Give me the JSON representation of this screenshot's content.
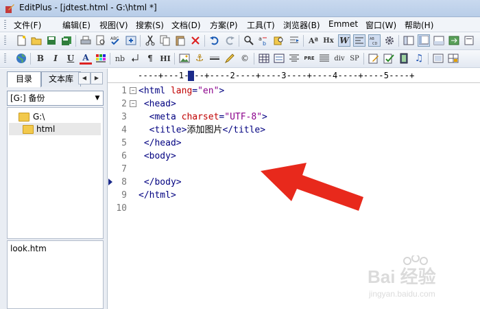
{
  "window": {
    "title": "EditPlus - [jdtest.html - G:\\html *]"
  },
  "menu": {
    "items": [
      "文件(F)",
      "编辑(E)",
      "视图(V)",
      "搜索(S)",
      "文档(D)",
      "方案(P)",
      "工具(T)",
      "浏览器(B)",
      "Emmet",
      "窗口(W)",
      "帮助(H)"
    ]
  },
  "toolbar2": {
    "bold": "B",
    "italic": "I",
    "underline": "U",
    "font": "A",
    "nbsp": "nb",
    "paragraph": "¶",
    "hi": "HI",
    "pre": "PRE",
    "div": "div",
    "span": "SP"
  },
  "sidebar": {
    "tabs": [
      "目录",
      "文本库"
    ],
    "drive": "[G:] 备份",
    "tree": [
      "G:\\",
      "html"
    ],
    "files": [
      "look.htm"
    ]
  },
  "ruler": {
    "text": "----+---1----+----2----+----3----+----4----+----5----+"
  },
  "editor": {
    "lines": [
      {
        "num": "1",
        "fold": "⊟",
        "indent": "",
        "parts": [
          [
            "tag",
            "<html "
          ],
          [
            "attr",
            "lang"
          ],
          [
            "tag",
            "="
          ],
          [
            "str",
            "\"en\""
          ],
          [
            "tag",
            ">"
          ]
        ]
      },
      {
        "num": "2",
        "fold": "⊟",
        "indent": " ",
        "parts": [
          [
            "tag",
            "<head>"
          ]
        ]
      },
      {
        "num": "3",
        "fold": "",
        "indent": "  ",
        "parts": [
          [
            "tag",
            "<meta "
          ],
          [
            "attr",
            "charset"
          ],
          [
            "tag",
            "="
          ],
          [
            "str",
            "\"UTF-8\""
          ],
          [
            "tag",
            ">"
          ]
        ]
      },
      {
        "num": "4",
        "fold": "",
        "indent": "  ",
        "parts": [
          [
            "tag",
            "<title>"
          ],
          [
            "txt",
            "添加图片"
          ],
          [
            "tag",
            "</title>"
          ]
        ]
      },
      {
        "num": "5",
        "fold": "",
        "indent": " ",
        "parts": [
          [
            "tag",
            "</head>"
          ]
        ]
      },
      {
        "num": "6",
        "fold": "",
        "indent": " ",
        "parts": [
          [
            "tag",
            "<body>"
          ]
        ]
      },
      {
        "num": "7",
        "fold": "",
        "indent": "",
        "parts": []
      },
      {
        "num": "8",
        "fold": "",
        "indent": " ",
        "parts": [
          [
            "tag",
            "</body>"
          ]
        ]
      },
      {
        "num": "9",
        "fold": "",
        "indent": "",
        "parts": [
          [
            "tag",
            "</html>"
          ]
        ]
      },
      {
        "num": "10",
        "fold": "",
        "indent": "",
        "parts": []
      }
    ],
    "current_line": "8"
  },
  "annotation": {
    "arrow_color": "#e8291c"
  },
  "watermark": {
    "brand": "Bai 经验",
    "url": "jingyan.baidu.com"
  }
}
